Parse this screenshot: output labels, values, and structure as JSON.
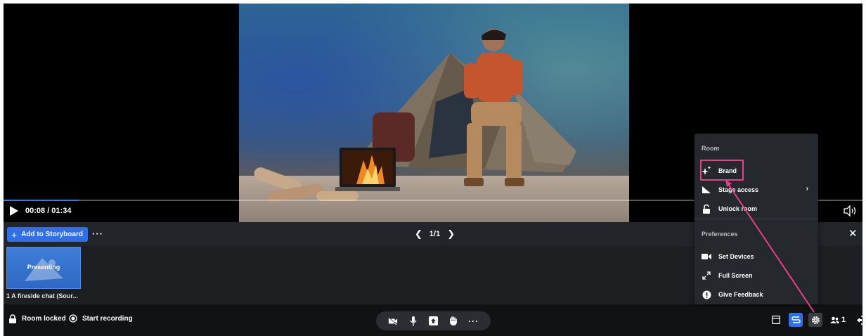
{
  "player": {
    "timecode": "00:08 / 01:34",
    "progress_fraction": 0.087
  },
  "storyboard": {
    "add_label": "Add to Storyboard",
    "more_label": "···",
    "pager": "1/1",
    "thumb_overlay": "Presenting",
    "thumb_caption": "1 A fireside chat (Sour..."
  },
  "bottom_bar": {
    "room_locked_label": "Room locked",
    "start_recording_label": "Start recording",
    "participants_count": "1"
  },
  "menu": {
    "room_section": "Room",
    "brand": "Brand",
    "stage_access": "Stage access",
    "unlock_room": "Unlock room",
    "preferences_section": "Preferences",
    "set_devices": "Set Devices",
    "full_screen": "Full Screen",
    "give_feedback": "Give Feedback"
  },
  "colors": {
    "accent": "#2f6fea",
    "annotation": "#e83e8c",
    "background": "#16181b"
  },
  "icons": [
    "play-icon",
    "volume-icon",
    "plus-icon",
    "chevron-left-icon",
    "chevron-right-icon",
    "close-icon",
    "lock-icon",
    "record-icon",
    "camera-off-icon",
    "microphone-icon",
    "share-screen-icon",
    "raise-hand-icon",
    "more-icon",
    "layout-icon",
    "switch-icon",
    "gear-icon",
    "participants-icon",
    "leave-icon",
    "sparkle-icon",
    "stage-icon",
    "unlock-icon",
    "video-camera-icon",
    "fullscreen-icon",
    "feedback-icon"
  ]
}
